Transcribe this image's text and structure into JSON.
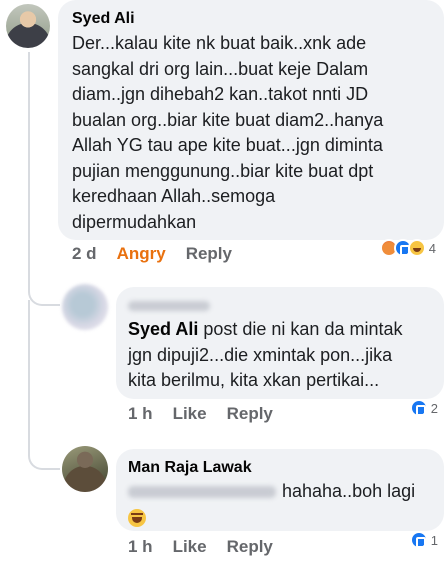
{
  "comments": [
    {
      "author": "Syed Ali",
      "text": "Der...kalau kite nk buat baik..xnk ade\nsangkal dri org lain...buat keje Dalam\ndiam..jgn dihebah2 kan..takot nnti JD\nbualan org..biar kite buat diam2..hanya\nAllah YG tau ape kite buat...jgn diminta\npujian menggunung..biar kite buat dpt\nkeredhaan Allah..semoga\ndipermudahkan",
      "time": "2 d",
      "reaction_label": "Angry",
      "reply_label": "Reply",
      "reaction_count": "4",
      "reaction_icons": [
        "angry-reaction-icon",
        "like-reaction-icon",
        "haha-reaction-icon"
      ]
    },
    {
      "mention": "Syed Ali",
      "text": " post die ni kan da mintak\njgn dipuji2...die xmintak pon...jika\nkita berilmu, kita xkan pertikai...",
      "time": "1 h",
      "like_label": "Like",
      "reply_label": "Reply",
      "reaction_count": "2",
      "reaction_icons": [
        "like-reaction-icon"
      ]
    },
    {
      "author": "Man Raja Lawak",
      "text": "hahaha..boh lagi",
      "emoji": "laughing-emoji-icon",
      "time": "1 h",
      "like_label": "Like",
      "reply_label": "Reply",
      "reaction_count": "1",
      "reaction_icons": [
        "like-reaction-icon"
      ]
    }
  ],
  "colors": {
    "bubble": "#f0f2f5",
    "angry_reaction": "#e9710f",
    "meta_text": "#65676b",
    "like_blue": "#1877f2"
  }
}
